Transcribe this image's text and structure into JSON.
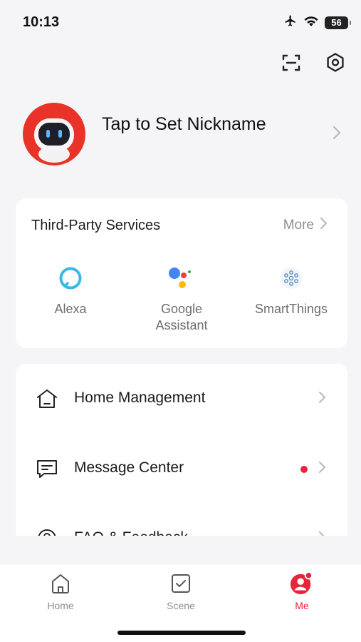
{
  "status": {
    "time": "10:13",
    "battery": "56",
    "icons": [
      "airplane-icon",
      "wifi-icon",
      "battery-icon"
    ]
  },
  "top_actions": {
    "icons": [
      "scan-icon",
      "settings-icon"
    ]
  },
  "profile": {
    "nickname": "Tap to Set Nickname"
  },
  "third_party": {
    "title": "Third-Party Services",
    "more_label": "More",
    "services": [
      {
        "label": "Alexa",
        "icon": "alexa-icon"
      },
      {
        "label": "Google\nAssistant",
        "icon": "google-assistant-icon"
      },
      {
        "label": "SmartThings",
        "icon": "smartthings-icon"
      }
    ]
  },
  "menu": {
    "items": [
      {
        "label": "Home Management",
        "icon": "home-outline-icon"
      },
      {
        "label": "Message Center",
        "icon": "message-icon",
        "has_dot": true
      },
      {
        "label": "FAQ & Feedback",
        "icon": "help-icon"
      }
    ]
  },
  "tabs": [
    {
      "label": "Home",
      "icon": "home-icon",
      "active": false
    },
    {
      "label": "Scene",
      "icon": "scene-icon",
      "active": false
    },
    {
      "label": "Me",
      "icon": "me-icon",
      "active": true
    }
  ],
  "colors": {
    "accent": "#e8243c",
    "background": "#f5f5f7",
    "card": "#ffffff",
    "muted_text": "#8e8e93"
  }
}
